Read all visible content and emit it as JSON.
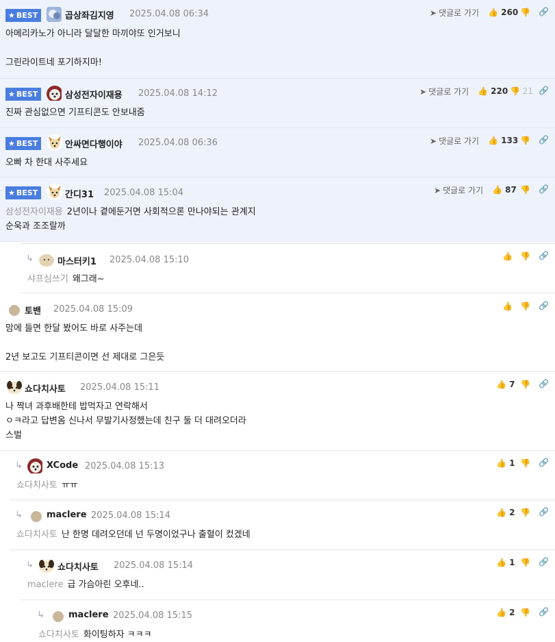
{
  "labels": {
    "best": "BEST",
    "goto": "댓글로 가기"
  },
  "comments": [
    {
      "nick": "곱상좌김지영",
      "time": "2025.04.08 06:34",
      "up": "260",
      "down": "",
      "line1": "아메리카노가 아니라 달달한 마끼야또 인거보니",
      "line2": "",
      "line3": "그린라이트네 포기하지마!"
    },
    {
      "nick": "삼성전자이재용",
      "time": "2025.04.08 14:12",
      "up": "220",
      "down": "21",
      "line1": "진짜 관심없으면 기프티콘도 안보내줌"
    },
    {
      "nick": "안싸면다행이야",
      "time": "2025.04.08 06:36",
      "up": "133",
      "down": "",
      "line1": "오빠 차 한대 사주세요"
    },
    {
      "nick": "간디31",
      "time": "2025.04.08 15:04",
      "up": "87",
      "down": "",
      "ref": "삼성전자이재용",
      "line1": "2년이나 곁에둔거면 사회적으론 만나야되는 관계지",
      "line2": "순욱과 조조랄까"
    },
    {
      "nick": "마스터키1",
      "time": "2025.04.08 15:10",
      "up": "",
      "down": "",
      "ref": "샤프심쓰기",
      "line1": "왜그래~"
    },
    {
      "nick": "토밴",
      "time": "2025.04.08 15:09",
      "up": "",
      "down": "",
      "line1": "맘에 들면 한달 봤어도 바로 사주는데",
      "line2": "2년 보고도 기프티콘이면 선 제대로 그은듯"
    },
    {
      "nick": "쇼다치사토",
      "time": "2025.04.08 15:11",
      "up": "7",
      "down": "",
      "line1": "나 짝녀 과후배한테 밥먹자고 연락해서",
      "line2": "ㅇㅋ라고 답변옴 신나서 무발기사정했는데 친구 둘 더 대려오더라",
      "line3": "스벌"
    },
    {
      "nick": "XCode",
      "time": "2025.04.08 15:13",
      "up": "1",
      "down": "",
      "ref": "쇼다치사토",
      "line1": "ㅠㅠ"
    },
    {
      "nick": "maclere",
      "time": "2025.04.08 15:14",
      "up": "2",
      "down": "",
      "ref": "쇼다치사토",
      "line1": "난 한명 데려오던데 넌 두명이었구나 출혈이 컸겠네"
    },
    {
      "nick": "쇼다치사토",
      "time": "2025.04.08 15:14",
      "up": "1",
      "down": "",
      "ref": "maclere",
      "line1": "급 가슴아린 오후네.."
    },
    {
      "nick": "maclere",
      "time": "2025.04.08 15:15",
      "up": "2",
      "down": "",
      "ref": "쇼다치사토",
      "line1": "화이팅하자 ㅋㅋㅋ"
    }
  ]
}
